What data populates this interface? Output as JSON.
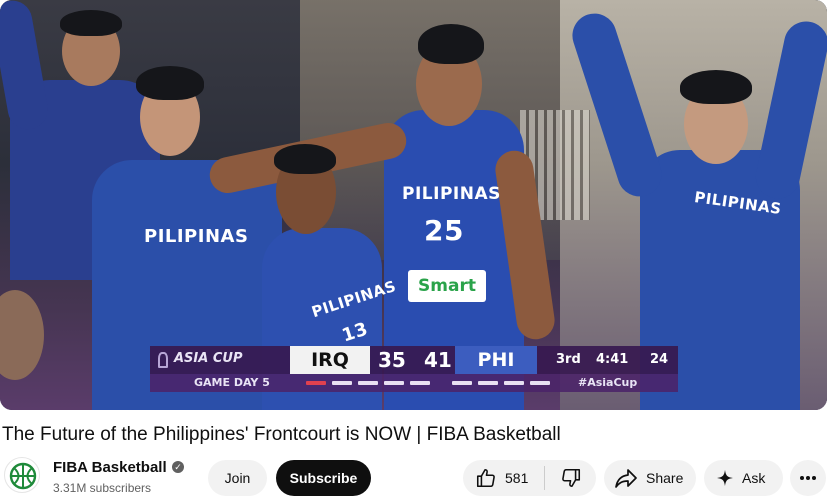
{
  "video": {
    "scoreboard": {
      "event": "ASIA CUP",
      "game_day": "GAME DAY 5",
      "team_left": "IRQ",
      "score_left": "35",
      "score_right": "41",
      "team_right": "PHI",
      "quarter": "3rd",
      "clock": "4:41",
      "shot_clock": "24",
      "hashtag": "#AsiaCup",
      "colors": {
        "bar": "#37195a",
        "left_team_bg": "#f2f2f2",
        "right_team_bg": "#3c5dbf",
        "foul_active": "#e0414f"
      }
    },
    "jerseys": {
      "left_bench": "PILIPINAS",
      "center_front": "PILIPINAS",
      "center_front_number": "13",
      "center_tall": "PILIPINAS",
      "center_tall_number": "25",
      "right_bench": "PILIPINAS",
      "sponsor": "Smart"
    }
  },
  "title": "The Future of the Philippines' Frontcourt is NOW | FIBA Basketball",
  "channel": {
    "name": "FIBA Basketball",
    "subscribers": "3.31M subscribers",
    "verified_icon": "verified-check-icon"
  },
  "actions": {
    "join": "Join",
    "subscribe": "Subscribe",
    "likes": "581",
    "share": "Share",
    "ask": "Ask"
  }
}
